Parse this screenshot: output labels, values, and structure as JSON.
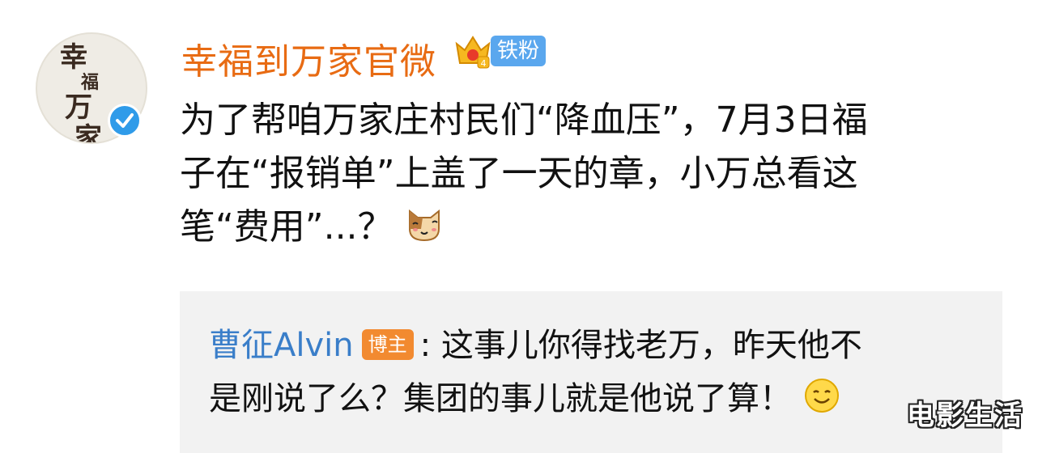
{
  "post": {
    "author": {
      "name": "幸福到万家官微",
      "avatar_text": [
        "幸",
        "福",
        "万",
        "家"
      ],
      "badge_label": "铁粉",
      "badge_color": "#5aa7ee",
      "level_icon": "crown-icon",
      "verified_icon": "verified-check-icon",
      "name_color": "#e86b13"
    },
    "text_lines": [
      "为了帮咱万家庄村民们“降血压”，7月3日福",
      "子在“报销单”上盖了一天的章，小万总看这",
      "笔“费用”...？"
    ],
    "emoji": "cat-face-icon"
  },
  "repost": {
    "user": "曹征Alvin",
    "user_color": "#3a7ec9",
    "role_badge": "博主",
    "role_badge_color": "#f28a30",
    "text_line1": ":  这事儿你得找老万，昨天他不",
    "text_line2": "是刚说了么？集团的事儿就是他说了算！",
    "emoji": "smile-face-icon"
  },
  "watermark": "电影生活"
}
